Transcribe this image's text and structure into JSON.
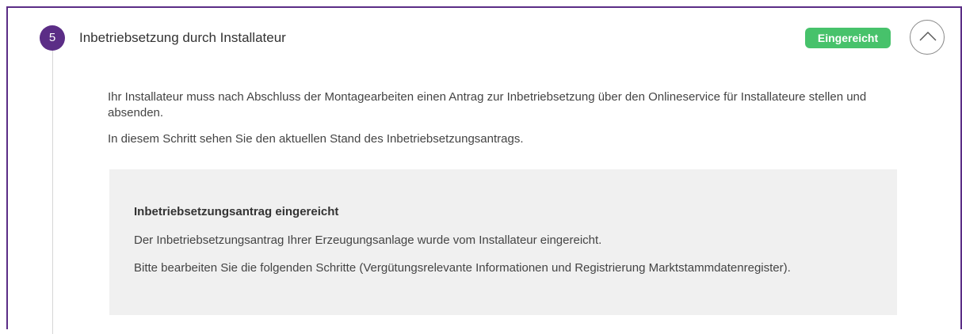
{
  "step": {
    "number": "5",
    "title": "Inbetriebsetzung durch Installateur",
    "status": "Eingereicht",
    "status_color": "#47c26b",
    "accent_color": "#5b2d86",
    "toggle_icon": "chevron-up-icon"
  },
  "content": {
    "paragraph1": "Ihr Installateur muss nach Abschluss der Montagearbeiten einen Antrag zur Inbetriebsetzung über den Onlineservice für Installateure stellen und absenden.",
    "paragraph2": "In diesem Schritt sehen Sie den aktuellen Stand des Inbetriebsetzungsantrags."
  },
  "info_box": {
    "heading": "Inbetriebsetzungsantrag eingereicht",
    "line1": "Der Inbetriebsetzungsantrag Ihrer Erzeugungsanlage wurde vom Installateur eingereicht.",
    "line2": "Bitte bearbeiten Sie die folgenden Schritte (Vergütungsrelevante Informationen und Registrierung Marktstammdatenregister)."
  }
}
